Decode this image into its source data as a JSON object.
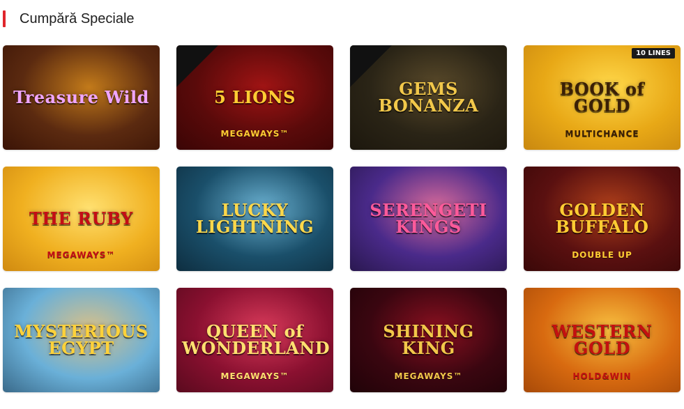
{
  "section": {
    "title": "Cumpără Speciale",
    "accent": "#e0262c"
  },
  "games": [
    {
      "name": "Treasure Wild",
      "sub": "",
      "colors": [
        "#5b2a10",
        "#c27a1a",
        "#3b1406"
      ],
      "text": "#f0a6ff",
      "drops": false
    },
    {
      "name": "5 LIONS",
      "sub": "MEGAWAYS™",
      "colors": [
        "#5a0a0a",
        "#a01414",
        "#3a0505"
      ],
      "text": "#ffcc33",
      "drops": true
    },
    {
      "name": "GEMS BONANZA",
      "sub": "",
      "colors": [
        "#2a2416",
        "#5a4a2a",
        "#1c170d"
      ],
      "text": "#f2c84a",
      "drops": true
    },
    {
      "name": "BOOK of GOLD",
      "sub": "MULTICHANCE",
      "colors": [
        "#e8a816",
        "#ffd84a",
        "#c98810"
      ],
      "text": "#3a1f06",
      "drops": false,
      "badge": "10 LINES"
    },
    {
      "name": "THE RUBY",
      "sub": "MEGAWAYS™",
      "colors": [
        "#f0b020",
        "#ffe070",
        "#d08a10"
      ],
      "text": "#c40d16",
      "drops": false
    },
    {
      "name": "LUCKY LIGHTNING",
      "sub": "",
      "colors": [
        "#1a4f6a",
        "#6ab0d0",
        "#0e2e40"
      ],
      "text": "#ffd84a",
      "drops": false
    },
    {
      "name": "SERENGETI KINGS",
      "sub": "",
      "colors": [
        "#4a2a8a",
        "#d86a9a",
        "#2a1850"
      ],
      "text": "#ff5a9a",
      "drops": false
    },
    {
      "name": "GOLDEN BUFFALO",
      "sub": "DOUBLE UP",
      "colors": [
        "#5a1010",
        "#b0401a",
        "#3a0808"
      ],
      "text": "#ffcc33",
      "drops": false
    },
    {
      "name": "MYSTERIOUS EGYPT",
      "sub": "",
      "colors": [
        "#6ab0d8",
        "#d8c088",
        "#3a6a8a"
      ],
      "text": "#ffd23a",
      "drops": false
    },
    {
      "name": "QUEEN of WONDERLAND",
      "sub": "MEGAWAYS™",
      "colors": [
        "#8a1030",
        "#d83a5a",
        "#5a0a1e"
      ],
      "text": "#ffe070",
      "drops": false
    },
    {
      "name": "SHINING KING",
      "sub": "MEGAWAYS™",
      "colors": [
        "#3a0610",
        "#8a1020",
        "#200308"
      ],
      "text": "#f2c84a",
      "drops": false
    },
    {
      "name": "WESTERN GOLD",
      "sub": "HOLD&WIN",
      "colors": [
        "#d86a10",
        "#f8c040",
        "#a84a08"
      ],
      "text": "#c41010",
      "drops": false
    }
  ]
}
